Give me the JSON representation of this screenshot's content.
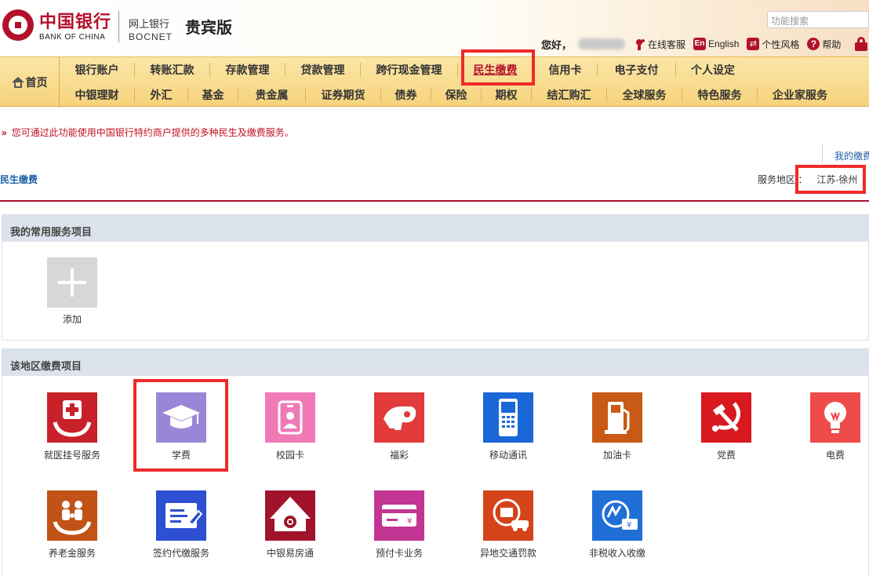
{
  "header": {
    "logo_cn": "中国银行",
    "logo_en": "BANK OF CHINA",
    "bank_cn": "网上银行",
    "bank_en": "BOCNET",
    "edition": "贵宾版",
    "search_placeholder": "功能搜索",
    "greeting": "您好，",
    "links": {
      "online_service": "在线客服",
      "english_icon": "En",
      "english": "English",
      "style": "个性风格",
      "help": "帮助"
    }
  },
  "nav": {
    "home": "首页",
    "row1": [
      "银行账户",
      "转账汇款",
      "存款管理",
      "贷款管理",
      "跨行现金管理",
      "民生缴费",
      "信用卡",
      "电子支付",
      "个人设定"
    ],
    "row2": [
      "中银理财",
      "外汇",
      "基金",
      "贵金属",
      "证券期货",
      "债券",
      "保险",
      "期权",
      "结汇购汇",
      "全球服务",
      "特色服务",
      "企业家服务"
    ],
    "active": "民生缴费"
  },
  "notice": {
    "arrow": "»",
    "text": "您可通过此功能使用中国银行特约商户提供的多种民生及缴费服务。"
  },
  "my_payments_tab": "我的缴费",
  "section_title": "民生缴费",
  "region": {
    "label": "服务地区 ：",
    "value": "江苏-徐州"
  },
  "common_panel": {
    "title": "我的常用服务项目",
    "add_label": "添加"
  },
  "region_panel": {
    "title": "该地区缴费项目",
    "services": [
      {
        "label": "就医挂号服务",
        "icon": "hospital-icon",
        "color": "#c8212a"
      },
      {
        "label": "学费",
        "icon": "graduation-cap-icon",
        "color": "#9a86d6"
      },
      {
        "label": "校园卡",
        "icon": "id-badge-icon",
        "color": "#f07ab6"
      },
      {
        "label": "福彩",
        "icon": "lottery-icon",
        "color": "#e23b3b"
      },
      {
        "label": "移动通讯",
        "icon": "mobile-phone-icon",
        "color": "#1a67d8"
      },
      {
        "label": "加油卡",
        "icon": "fuel-pump-icon",
        "color": "#c85a16"
      },
      {
        "label": "党费",
        "icon": "party-emblem-icon",
        "color": "#d8191f"
      },
      {
        "label": "电费",
        "icon": "light-bulb-icon",
        "color": "#ef4b4b"
      },
      {
        "label": "养老金服务",
        "icon": "family-icon",
        "color": "#c25316"
      },
      {
        "label": "签约代缴服务",
        "icon": "contract-icon",
        "color": "#2d4fd1"
      },
      {
        "label": "中银易房通",
        "icon": "house-icon",
        "color": "#a0132b"
      },
      {
        "label": "预付卡业务",
        "icon": "prepaid-card-icon",
        "color": "#c23592"
      },
      {
        "label": "异地交通罚款",
        "icon": "traffic-fine-icon",
        "color": "#d4431a"
      },
      {
        "label": "非税收入收缴",
        "icon": "tax-icon",
        "color": "#1f6fd6"
      }
    ]
  }
}
